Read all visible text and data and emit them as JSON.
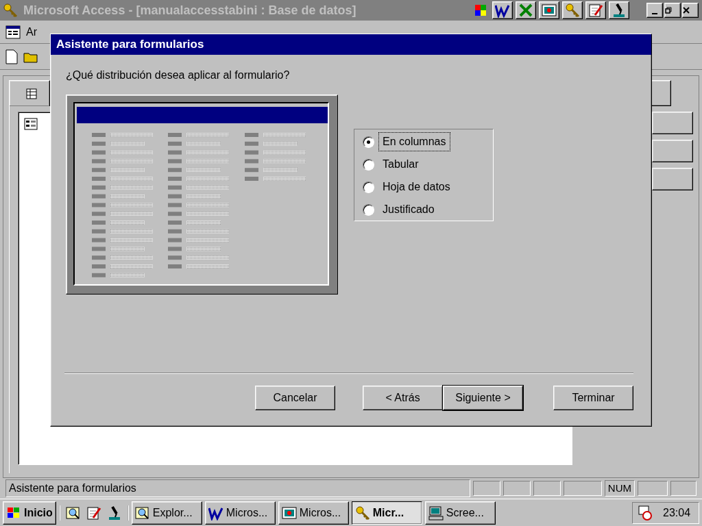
{
  "app_window": {
    "title": "Microsoft Access - [manualaccesstabini : Base de datos]",
    "menu": [
      "Ar"
    ]
  },
  "dialog": {
    "title": "Asistente para formularios",
    "question": "¿Qué distribución desea aplicar al formulario?",
    "layouts": [
      {
        "label": "En columnas",
        "selected": true
      },
      {
        "label": "Tabular",
        "selected": false
      },
      {
        "label": "Hoja de datos",
        "selected": false
      },
      {
        "label": "Justificado",
        "selected": false
      }
    ],
    "buttons": [
      {
        "label": "Cancelar",
        "default": false
      },
      {
        "label": "< Atrás",
        "default": false
      },
      {
        "label": "Siguiente >",
        "default": true
      },
      {
        "label": "Terminar",
        "default": false
      }
    ]
  },
  "status_bar": {
    "text": "Asistente para formularios",
    "indicator": "NUM"
  },
  "taskbar": {
    "start": "Inicio",
    "tasks": [
      {
        "kind": "search",
        "label": "Explor...",
        "selected": false
      },
      {
        "kind": "word",
        "label": "Micros...",
        "selected": false
      },
      {
        "kind": "slides",
        "label": "Micros...",
        "selected": false
      },
      {
        "kind": "key",
        "label": "Micr...",
        "selected": true
      },
      {
        "kind": "computer",
        "label": "Scree...",
        "selected": false
      }
    ],
    "clock": "23:04"
  }
}
